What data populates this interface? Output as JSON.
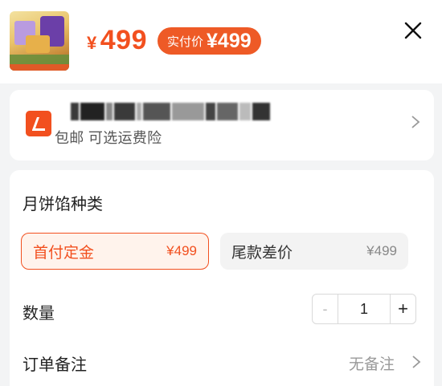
{
  "header": {
    "price_currency": "¥",
    "price_value": "499",
    "pay_badge_label": "实付价",
    "pay_badge_amount": "¥499"
  },
  "shipping": {
    "text": "包邮 可选运费险"
  },
  "spec": {
    "title": "月饼馅种类",
    "options": [
      {
        "name": "首付定金",
        "value": "¥499",
        "selected": true
      },
      {
        "name": "尾款差价",
        "value": "¥499",
        "selected": false
      }
    ]
  },
  "quantity": {
    "label": "数量",
    "minus": "-",
    "value": "1",
    "plus": "+"
  },
  "note": {
    "label": "订单备注",
    "value": "无备注"
  },
  "colors": {
    "accent": "#f2501f",
    "badge": "#ee5a26"
  }
}
